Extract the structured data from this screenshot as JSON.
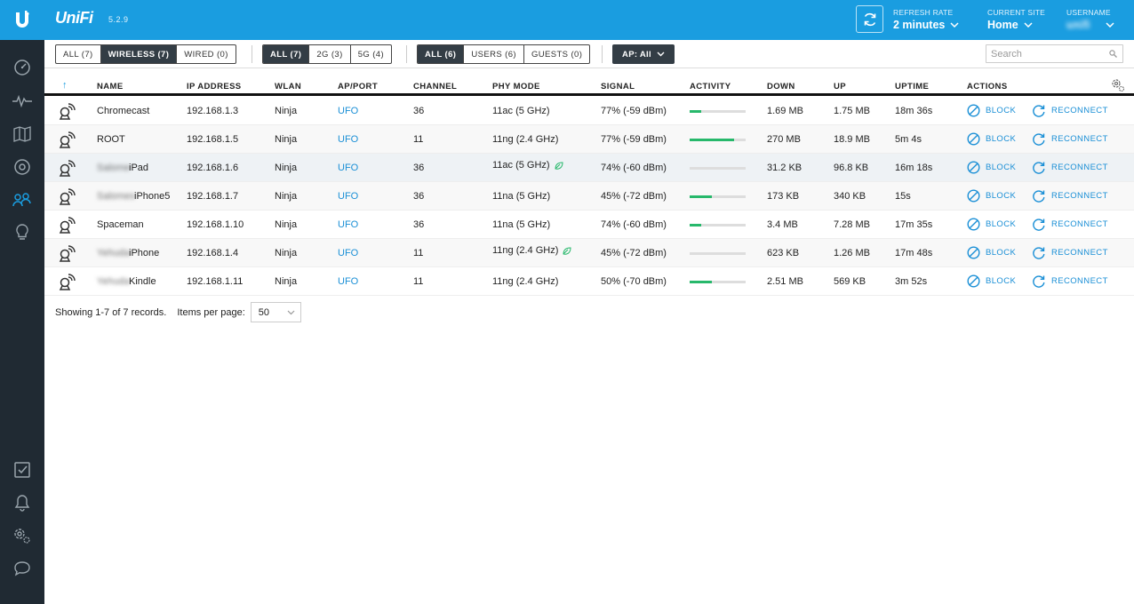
{
  "header": {
    "brand": "UniFi",
    "version": "5.2.9",
    "refresh_rate_label": "REFRESH RATE",
    "refresh_rate_value": "2 minutes",
    "current_site_label": "CURRENT SITE",
    "current_site_value": "Home",
    "username_label": "USERNAME",
    "username_value": "unifi"
  },
  "filters": {
    "type": [
      "ALL (7)",
      "WIRELESS (7)",
      "WIRED (0)"
    ],
    "band": [
      "ALL (7)",
      "2G (3)",
      "5G (4)"
    ],
    "users": [
      "ALL (6)",
      "USERS (6)",
      "GUESTS (0)"
    ],
    "ap": "AP: All",
    "search_placeholder": "Search"
  },
  "table": {
    "sort_arrow": "↑",
    "columns": [
      "NAME",
      "IP ADDRESS",
      "WLAN",
      "AP/PORT",
      "CHANNEL",
      "PHY MODE",
      "SIGNAL",
      "ACTIVITY",
      "DOWN",
      "UP",
      "UPTIME",
      "ACTIONS"
    ],
    "rows": [
      {
        "name_blur": "",
        "name": "Chromecast",
        "ip": "192.168.1.3",
        "wlan": "Ninja",
        "ap": "UFO",
        "channel": "36",
        "phy": "11ac (5 GHz)",
        "leaf": false,
        "signal": "77% (-59 dBm)",
        "activity": 0.2,
        "down": "1.69 MB",
        "up": "1.75 MB",
        "uptime": "18m 36s"
      },
      {
        "name_blur": "",
        "name": "ROOT",
        "ip": "192.168.1.5",
        "wlan": "Ninja",
        "ap": "UFO",
        "channel": "11",
        "phy": "11ng (2.4 GHz)",
        "leaf": false,
        "signal": "77% (-59 dBm)",
        "activity": 0.8,
        "down": "270 MB",
        "up": "18.9 MB",
        "uptime": "5m 4s"
      },
      {
        "name_blur": "Salome",
        "name": "iPad",
        "ip": "192.168.1.6",
        "wlan": "Ninja",
        "ap": "UFO",
        "channel": "36",
        "phy": "11ac (5 GHz)",
        "leaf": true,
        "signal": "74% (-60 dBm)",
        "activity": 0.0,
        "down": "31.2 KB",
        "up": "96.8 KB",
        "uptime": "16m 18s"
      },
      {
        "name_blur": "Salomes",
        "name": "iPhone5",
        "ip": "192.168.1.7",
        "wlan": "Ninja",
        "ap": "UFO",
        "channel": "36",
        "phy": "11na (5 GHz)",
        "leaf": false,
        "signal": "45% (-72 dBm)",
        "activity": 0.4,
        "down": "173 KB",
        "up": "340 KB",
        "uptime": "15s"
      },
      {
        "name_blur": "",
        "name": "Spaceman",
        "ip": "192.168.1.10",
        "wlan": "Ninja",
        "ap": "UFO",
        "channel": "36",
        "phy": "11na (5 GHz)",
        "leaf": false,
        "signal": "74% (-60 dBm)",
        "activity": 0.2,
        "down": "3.4 MB",
        "up": "7.28 MB",
        "uptime": "17m 35s"
      },
      {
        "name_blur": "Yehuda",
        "name": "iPhone",
        "ip": "192.168.1.4",
        "wlan": "Ninja",
        "ap": "UFO",
        "channel": "11",
        "phy": "11ng (2.4 GHz)",
        "leaf": true,
        "signal": "45% (-72 dBm)",
        "activity": 0.0,
        "down": "623 KB",
        "up": "1.26 MB",
        "uptime": "17m 48s"
      },
      {
        "name_blur": "Yehuda",
        "name": "Kindle",
        "ip": "192.168.1.11",
        "wlan": "Ninja",
        "ap": "UFO",
        "channel": "11",
        "phy": "11ng (2.4 GHz)",
        "leaf": false,
        "signal": "50% (-70 dBm)",
        "activity": 0.4,
        "down": "2.51 MB",
        "up": "569 KB",
        "uptime": "3m 52s"
      }
    ],
    "block_label": "BLOCK",
    "reconnect_label": "RECONNECT"
  },
  "footer": {
    "records": "Showing 1-7 of 7 records.",
    "items_per_page_label": "Items per page:",
    "items_per_page": "50"
  },
  "colors": {
    "topbar": "#1a9de0",
    "sidebar": "#202a33",
    "link": "#1a8fd6",
    "activity": "#27b86b"
  },
  "sidebar_icons": [
    "dashboard-icon",
    "statistics-icon",
    "map-icon",
    "devices-icon",
    "clients-icon",
    "insights-icon",
    "alerts-check-icon",
    "bell-icon",
    "settings-icon",
    "chat-icon"
  ]
}
